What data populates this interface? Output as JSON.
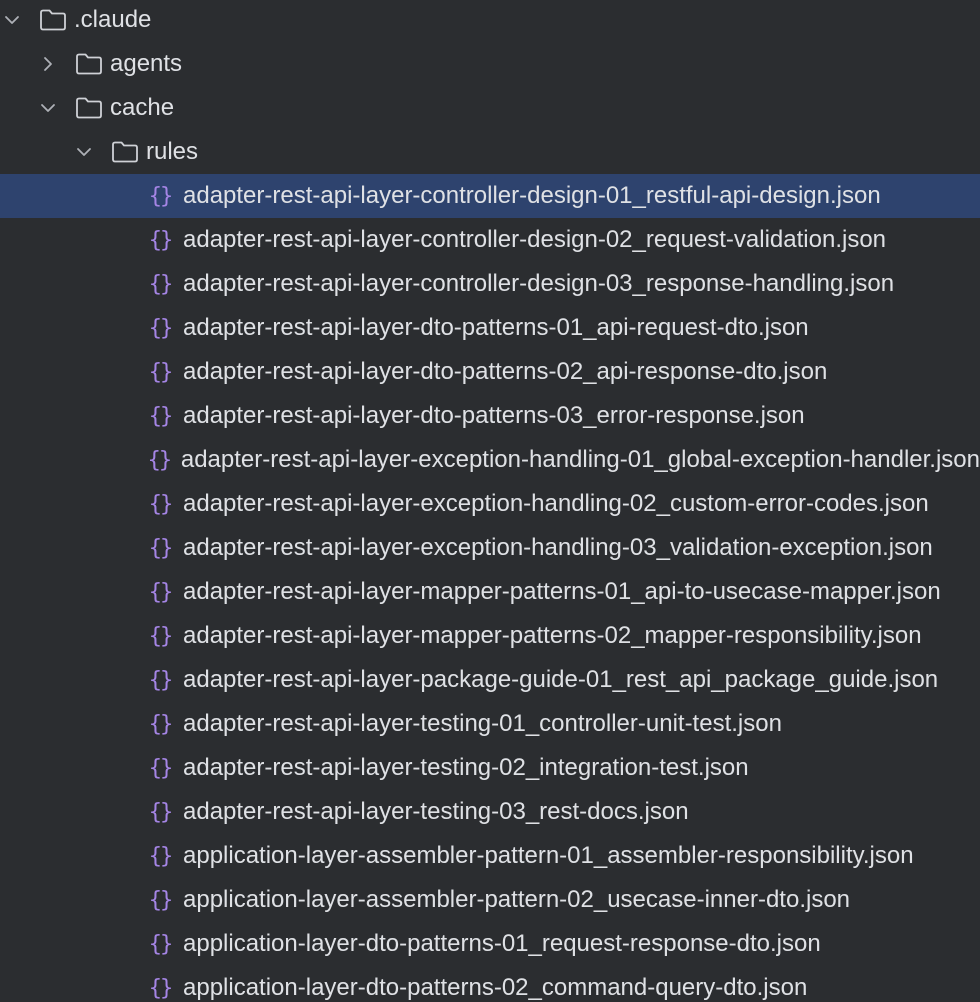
{
  "tree": {
    "root": {
      "label": ".claude",
      "expanded": true,
      "icon": "folder-icon"
    },
    "agents": {
      "label": "agents",
      "expanded": false,
      "icon": "folder-icon"
    },
    "cache": {
      "label": "cache",
      "expanded": true,
      "icon": "folder-icon"
    },
    "rules": {
      "label": "rules",
      "expanded": true,
      "icon": "folder-icon"
    },
    "files": [
      {
        "label": "adapter-rest-api-layer-controller-design-01_restful-api-design.json",
        "selected": true,
        "icon": "json-file-icon"
      },
      {
        "label": "adapter-rest-api-layer-controller-design-02_request-validation.json",
        "icon": "json-file-icon"
      },
      {
        "label": "adapter-rest-api-layer-controller-design-03_response-handling.json",
        "icon": "json-file-icon"
      },
      {
        "label": "adapter-rest-api-layer-dto-patterns-01_api-request-dto.json",
        "icon": "json-file-icon"
      },
      {
        "label": "adapter-rest-api-layer-dto-patterns-02_api-response-dto.json",
        "icon": "json-file-icon"
      },
      {
        "label": "adapter-rest-api-layer-dto-patterns-03_error-response.json",
        "icon": "json-file-icon"
      },
      {
        "label": "adapter-rest-api-layer-exception-handling-01_global-exception-handler.json",
        "icon": "json-file-icon"
      },
      {
        "label": "adapter-rest-api-layer-exception-handling-02_custom-error-codes.json",
        "icon": "json-file-icon"
      },
      {
        "label": "adapter-rest-api-layer-exception-handling-03_validation-exception.json",
        "icon": "json-file-icon"
      },
      {
        "label": "adapter-rest-api-layer-mapper-patterns-01_api-to-usecase-mapper.json",
        "icon": "json-file-icon"
      },
      {
        "label": "adapter-rest-api-layer-mapper-patterns-02_mapper-responsibility.json",
        "icon": "json-file-icon"
      },
      {
        "label": "adapter-rest-api-layer-package-guide-01_rest_api_package_guide.json",
        "icon": "json-file-icon"
      },
      {
        "label": "adapter-rest-api-layer-testing-01_controller-unit-test.json",
        "icon": "json-file-icon"
      },
      {
        "label": "adapter-rest-api-layer-testing-02_integration-test.json",
        "icon": "json-file-icon"
      },
      {
        "label": "adapter-rest-api-layer-testing-03_rest-docs.json",
        "icon": "json-file-icon"
      },
      {
        "label": "application-layer-assembler-pattern-01_assembler-responsibility.json",
        "icon": "json-file-icon"
      },
      {
        "label": "application-layer-assembler-pattern-02_usecase-inner-dto.json",
        "icon": "json-file-icon"
      },
      {
        "label": "application-layer-dto-patterns-01_request-response-dto.json",
        "icon": "json-file-icon"
      },
      {
        "label": "application-layer-dto-patterns-02_command-query-dto.json",
        "icon": "json-file-icon"
      }
    ]
  },
  "icons": {
    "json": "{}"
  },
  "colors": {
    "background": "#2b2d30",
    "selection": "#2e436e",
    "text": "#dfe1e5",
    "json_icon": "#a585e5"
  }
}
